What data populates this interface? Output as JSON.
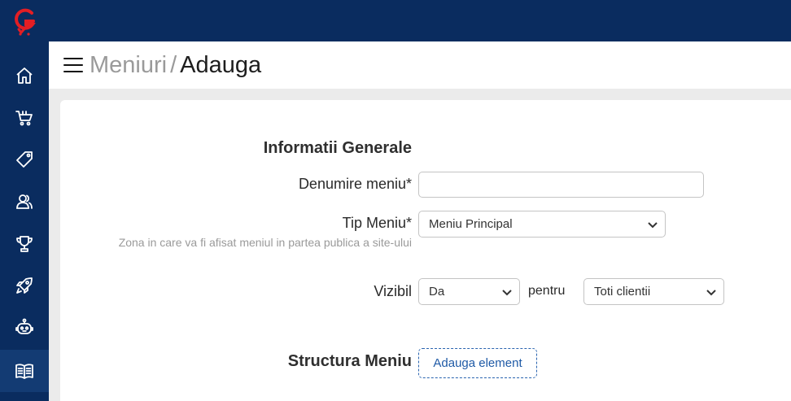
{
  "brand": {
    "logo_letter": "G",
    "logo_color": "#e31e24"
  },
  "colors": {
    "sidebar": "#0a2c5f",
    "sidebar_active": "#133b73",
    "accent": "#1f5aa6"
  },
  "sidebar": {
    "items": [
      {
        "icon": "home-icon"
      },
      {
        "icon": "shopping-cart-icon"
      },
      {
        "icon": "tag-icon"
      },
      {
        "icon": "users-icon"
      },
      {
        "icon": "trophy-icon"
      },
      {
        "icon": "rocket-icon"
      },
      {
        "icon": "robot-icon"
      },
      {
        "icon": "book-icon",
        "active": true
      }
    ]
  },
  "header": {
    "parent": "Meniuri",
    "separator": "/",
    "current": "Adauga"
  },
  "form": {
    "general_title": "Informatii Generale",
    "name_label": "Denumire meniu*",
    "name_value": "",
    "type_label": "Tip Meniu*",
    "type_hint": "Zona in care va fi afisat meniul in partea publica a site-ului",
    "type_value": "Meniu Principal",
    "visible_label": "Vizibil",
    "visible_value": "Da",
    "for_label": "pentru",
    "clients_value": "Toti clientii",
    "structure_title": "Structura Meniu",
    "add_element_label": "Adauga element"
  }
}
